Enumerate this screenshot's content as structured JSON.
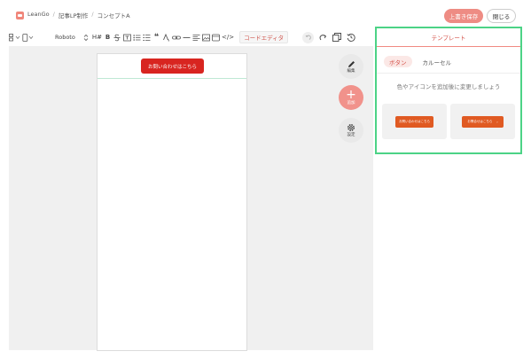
{
  "header": {
    "breadcrumbs": [
      "LeanGo",
      "記事LP制作",
      "コンセプトA"
    ],
    "separator": "/",
    "save_label": "上書き保存",
    "close_label": "閉じる"
  },
  "toolbar": {
    "font_name": "Roboto",
    "heading_label": "H#",
    "bold_label": "B",
    "quote_label": "❝",
    "code_editor_label": "コードエディタ",
    "code_tag_label": "</>"
  },
  "canvas": {
    "phone_button_label": "お問い合わせはこちら"
  },
  "floating_actions": {
    "edit_label": "編集",
    "add_label": "追加",
    "settings_label": "設定"
  },
  "panel": {
    "title": "テンプレート",
    "tabs": [
      {
        "label": "ボタン",
        "active": true
      },
      {
        "label": "カルーセル",
        "active": false
      }
    ],
    "hint": "色やアイコンを追加後に変更しましょう",
    "templates": [
      {
        "label": "お問い合わせはこちら"
      },
      {
        "label": "お問合せはこちら",
        "arrow": "›"
      }
    ]
  },
  "colors": {
    "accent": "#ee8c84",
    "selection_border": "#4cd386",
    "cta_red": "#d82520",
    "template_orange": "#e05a22"
  }
}
